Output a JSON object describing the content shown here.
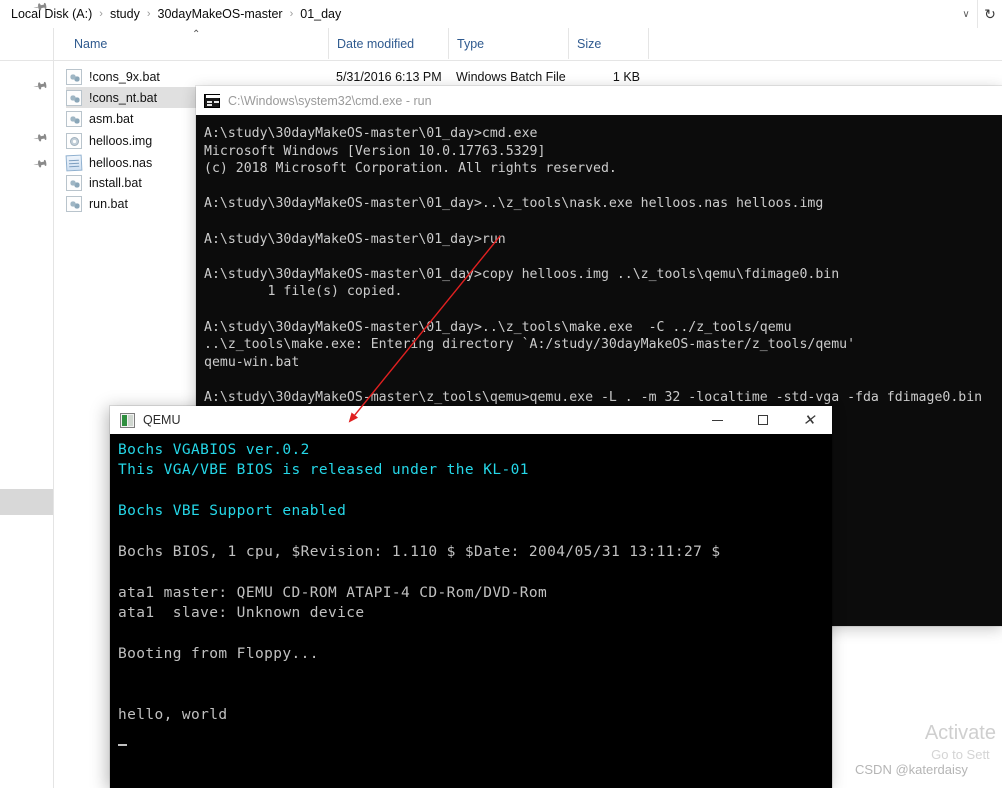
{
  "explorer": {
    "breadcrumb": {
      "items": [
        "Local Disk (A:)",
        "study",
        "30dayMakeOS-master",
        "01_day"
      ],
      "separator": "›",
      "chevron": "∨",
      "refresh": "↻"
    },
    "columns": [
      {
        "key": "name",
        "label": "Name"
      },
      {
        "key": "date",
        "label": "Date modified"
      },
      {
        "key": "type",
        "label": "Type"
      },
      {
        "key": "size",
        "label": "Size"
      }
    ],
    "sort_caret": "⌃",
    "nav_pins": [
      "pin-icon",
      "pin-icon",
      "pin-icon",
      "pin-icon"
    ],
    "files": [
      {
        "name": "!cons_9x.bat",
        "icon": "bat-file-icon",
        "date": "5/31/2016 6:13 PM",
        "type": "Windows Batch File",
        "size": "1 KB",
        "selected": false
      },
      {
        "name": "!cons_nt.bat",
        "icon": "bat-file-icon",
        "date": "",
        "type": "",
        "size": "",
        "selected": true
      },
      {
        "name": "asm.bat",
        "icon": "bat-file-icon",
        "date": "",
        "type": "",
        "size": "",
        "selected": false
      },
      {
        "name": "helloos.img",
        "icon": "disc-image-icon",
        "date": "",
        "type": "",
        "size": "",
        "selected": false
      },
      {
        "name": "helloos.nas",
        "icon": "text-file-icon",
        "date": "",
        "type": "",
        "size": "",
        "selected": false
      },
      {
        "name": "install.bat",
        "icon": "bat-file-icon",
        "date": "",
        "type": "",
        "size": "",
        "selected": false
      },
      {
        "name": "run.bat",
        "icon": "bat-file-icon",
        "date": "",
        "type": "",
        "size": "",
        "selected": false
      }
    ]
  },
  "cmd_window": {
    "title": "C:\\Windows\\system32\\cmd.exe - run",
    "icon": "cmd-console-icon",
    "lines": [
      "A:\\study\\30dayMakeOS-master\\01_day>cmd.exe",
      "Microsoft Windows [Version 10.0.17763.5329]",
      "(c) 2018 Microsoft Corporation. All rights reserved.",
      "",
      "A:\\study\\30dayMakeOS-master\\01_day>..\\z_tools\\nask.exe helloos.nas helloos.img",
      "",
      "A:\\study\\30dayMakeOS-master\\01_day>run",
      "",
      "A:\\study\\30dayMakeOS-master\\01_day>copy helloos.img ..\\z_tools\\qemu\\fdimage0.bin",
      "        1 file(s) copied.",
      "",
      "A:\\study\\30dayMakeOS-master\\01_day>..\\z_tools\\make.exe  -C ../z_tools/qemu",
      "..\\z_tools\\make.exe: Entering directory `A:/study/30dayMakeOS-master/z_tools/qemu'",
      "qemu-win.bat",
      "",
      "A:\\study\\30dayMakeOS-master\\z_tools\\qemu>qemu.exe -L . -m 32 -localtime -std-vga -fda fdimage0.bin"
    ]
  },
  "qemu_window": {
    "title": "QEMU",
    "icon": "qemu-app-icon",
    "buttons": {
      "minimize": "minimize-button",
      "maximize": "maximize-button",
      "close": "close-button",
      "close_glyph": "✕"
    },
    "console": [
      {
        "text": "Bochs VGABIOS ver.0.2",
        "color": "cyan"
      },
      {
        "text": "This VGA/VBE BIOS is released under the KL-01",
        "color": "cyan"
      },
      {
        "text": "",
        "color": "blank"
      },
      {
        "text": "Bochs VBE Support enabled",
        "color": "cyan"
      },
      {
        "text": "",
        "color": "blank"
      },
      {
        "text": "Bochs BIOS, 1 cpu, $Revision: 1.110 $ $Date: 2004/05/31 13:11:27 $",
        "color": "gray"
      },
      {
        "text": "",
        "color": "blank"
      },
      {
        "text": "ata1 master: QEMU CD-ROM ATAPI-4 CD-Rom/DVD-Rom",
        "color": "gray"
      },
      {
        "text": "ata1  slave: Unknown device",
        "color": "gray"
      },
      {
        "text": "",
        "color": "blank"
      },
      {
        "text": "Booting from Floppy...",
        "color": "gray"
      },
      {
        "text": "",
        "color": "blank"
      },
      {
        "text": "",
        "color": "blank"
      },
      {
        "text": "hello, world",
        "color": "gray"
      }
    ]
  },
  "annotation": {
    "arrow_color": "#e02020",
    "arrow_name": "red-annotation-arrow"
  },
  "watermarks": {
    "activate_line1": "Activate",
    "activate_line2": "Go to Sett",
    "csdn": "CSDN @katerdaisy"
  }
}
